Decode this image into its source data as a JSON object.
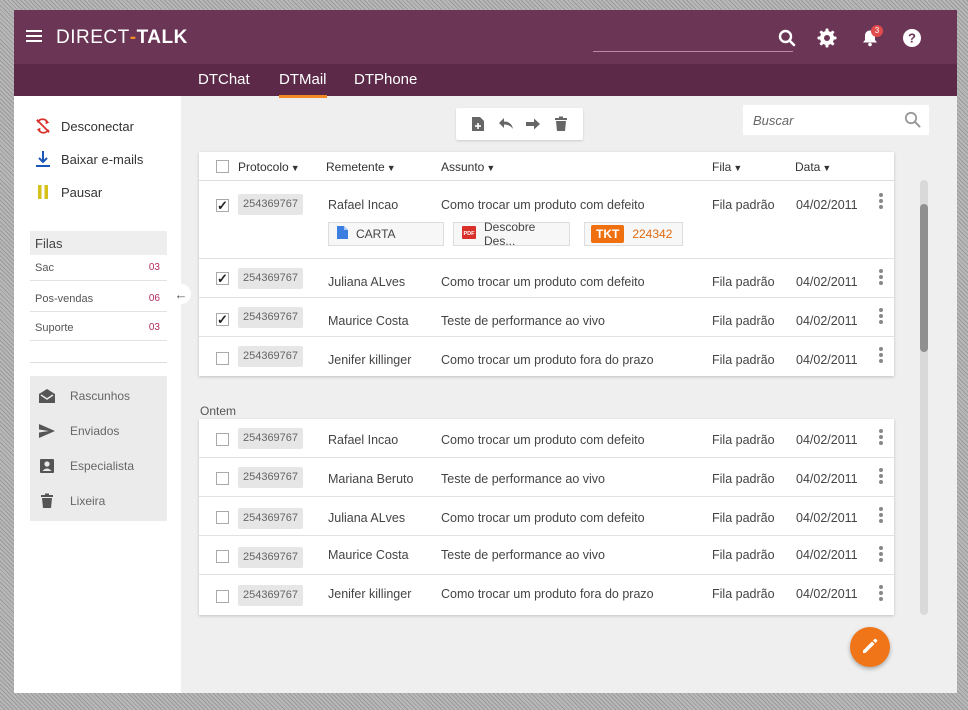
{
  "header": {
    "logo_left": "DIRECT",
    "logo_dot": "-",
    "logo_right": "TALK",
    "notification_count": "3",
    "tabs": [
      {
        "label": "DTChat",
        "active": false
      },
      {
        "label": "DTMail",
        "active": true
      },
      {
        "label": "DTPhone",
        "active": false
      }
    ],
    "accent_color": "#f08a24",
    "brand_color": "#6b3556"
  },
  "sidebar": {
    "actions": [
      {
        "label": "Desconectar",
        "icon": "disconnect-icon"
      },
      {
        "label": "Baixar e-mails",
        "icon": "download-icon"
      },
      {
        "label": "Pausar",
        "icon": "pause-icon"
      }
    ],
    "filas_title": "Filas",
    "filas": [
      {
        "name": "Sac",
        "count": "03"
      },
      {
        "name": "Pos-vendas",
        "count": "06"
      },
      {
        "name": "Suporte",
        "count": "03"
      }
    ],
    "folders": [
      {
        "label": "Rascunhos",
        "icon": "drafts-icon"
      },
      {
        "label": "Enviados",
        "icon": "send-icon"
      },
      {
        "label": "Especialista",
        "icon": "contact-icon"
      },
      {
        "label": "Lixeira",
        "icon": "trash-icon"
      }
    ]
  },
  "toolbar": {
    "search_placeholder": "Buscar"
  },
  "table": {
    "columns": [
      "Protocolo",
      "Remetente",
      "Assunto",
      "Fila",
      "Data"
    ],
    "group_label": "Ontem",
    "today_rows": [
      {
        "checked": true,
        "protocol": "254369767",
        "sender": "Rafael Incao",
        "subject": "Como trocar um produto com defeito",
        "queue": "Fila padrão",
        "date": "04/02/2011"
      },
      {
        "checked": true,
        "protocol": "254369767",
        "sender": "Juliana ALves",
        "subject": "Como trocar um produto com defeito",
        "queue": "Fila padrão",
        "date": "04/02/2011"
      },
      {
        "checked": true,
        "protocol": "254369767",
        "sender": "Maurice Costa",
        "subject": "Teste de performance ao vivo",
        "queue": "Fila padrão",
        "date": "04/02/2011"
      },
      {
        "checked": false,
        "protocol": "254369767",
        "sender": "Jenifer killinger",
        "subject": "Como trocar um produto fora do prazo",
        "queue": "Fila padrão",
        "date": "04/02/2011"
      }
    ],
    "attachments": {
      "doc": "CARTA",
      "pdf": "Descobre Des...",
      "tkt_label": "TKT",
      "tkt_number": "224342"
    },
    "yesterday_rows": [
      {
        "checked": false,
        "protocol": "254369767",
        "sender": "Rafael Incao",
        "subject": "Como trocar um produto com defeito",
        "queue": "Fila padrão",
        "date": "04/02/2011"
      },
      {
        "checked": false,
        "protocol": "254369767",
        "sender": "Mariana Beruto",
        "subject": "Teste de performance ao vivo",
        "queue": "Fila padrão",
        "date": "04/02/2011"
      },
      {
        "checked": false,
        "protocol": "254369767",
        "sender": "Juliana ALves",
        "subject": "Como trocar um produto com defeito",
        "queue": "Fila padrão",
        "date": "04/02/2011"
      },
      {
        "checked": false,
        "protocol": "254369767",
        "sender": "Maurice Costa",
        "subject": "Teste de performance ao vivo",
        "queue": "Fila padrão",
        "date": "04/02/2011"
      },
      {
        "checked": false,
        "protocol": "254369767",
        "sender": "Jenifer killinger",
        "subject": "Como trocar um produto fora do prazo",
        "queue": "Fila padrão",
        "date": "04/02/2011"
      }
    ]
  }
}
